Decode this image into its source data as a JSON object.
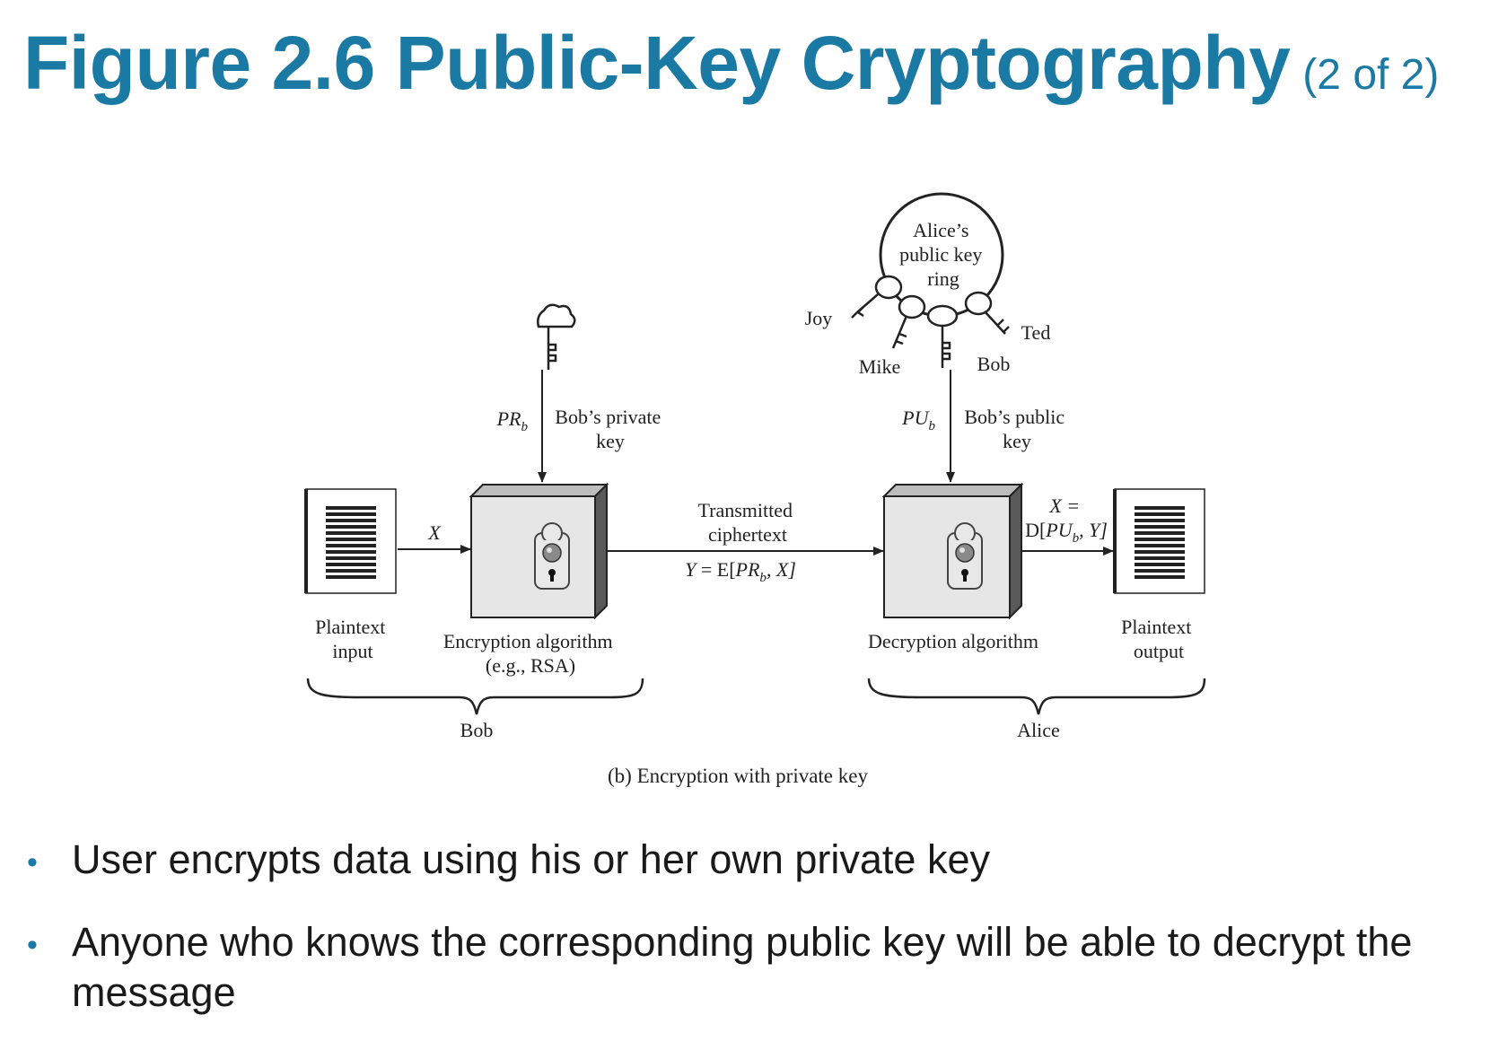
{
  "title": {
    "main": "Figure 2.6 Public-Key Cryptography",
    "sub": "(2 of 2)"
  },
  "diagram": {
    "keyring_label": [
      "Alice’s",
      "public key",
      "ring"
    ],
    "ring_keys": [
      "Joy",
      "Mike",
      "Bob",
      "Ted"
    ],
    "private_key": {
      "symbol": "PR",
      "sub": "b",
      "desc": [
        "Bob’s private",
        "key"
      ]
    },
    "public_key": {
      "symbol": "PU",
      "sub": "b",
      "desc": [
        "Bob’s public",
        "key"
      ]
    },
    "plaintext_input": [
      "Plaintext",
      "input"
    ],
    "plaintext_output": [
      "Plaintext",
      "output"
    ],
    "x_label": "X",
    "encryption": [
      "Encryption algorithm",
      "(e.g., RSA)"
    ],
    "decryption": "Decryption algorithm",
    "transmitted": [
      "Transmitted",
      "ciphertext"
    ],
    "cipher_formula": {
      "lhs": "Y",
      "eq": " = E[",
      "sym": "PR",
      "sub": "b",
      "rest": ", X]"
    },
    "output_formula": {
      "line1": "X =",
      "pre": "D[",
      "sym": "PU",
      "sub": "b",
      "rest": ", Y]"
    },
    "bob_group": "Bob",
    "alice_group": "Alice",
    "caption": "(b) Encryption with private key"
  },
  "bullets": [
    "User encrypts data using his or her own private key",
    "Anyone who knows the corresponding public key will be able to decrypt the message"
  ]
}
